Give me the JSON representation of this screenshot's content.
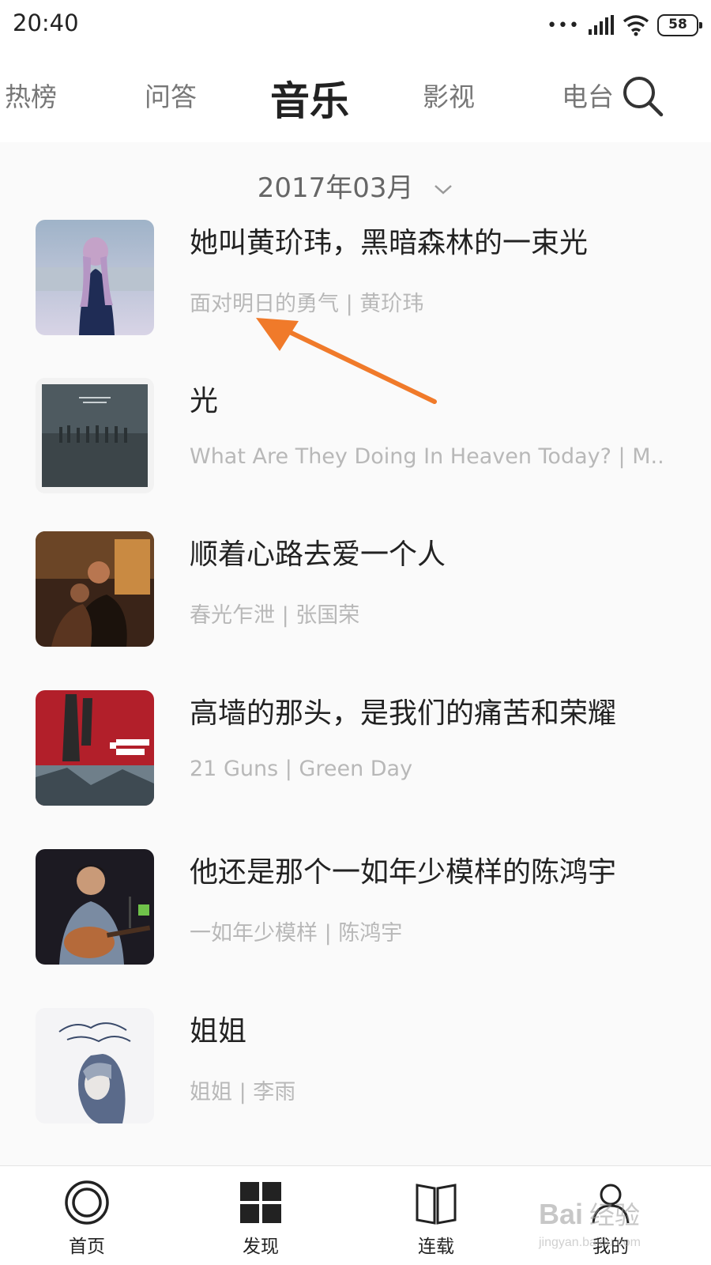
{
  "status_bar": {
    "time": "20:40",
    "signal_dots": "•••",
    "battery": "58",
    "icons": [
      "signal-icon",
      "wifi-icon",
      "battery-icon"
    ]
  },
  "top_nav": {
    "tabs": [
      {
        "label": "热榜",
        "active": false
      },
      {
        "label": "问答",
        "active": false
      },
      {
        "label": "音乐",
        "active": true
      },
      {
        "label": "影视",
        "active": false
      },
      {
        "label": "电台",
        "active": false
      }
    ],
    "search_icon": "search-icon"
  },
  "month_selector": {
    "label": "2017年03月",
    "icon": "chevron-down-icon"
  },
  "items": [
    {
      "title": "她叫黄玠玮，黑暗森林的一束光",
      "subtitle": "面对明日的勇气 | 黄玠玮"
    },
    {
      "title": "光",
      "subtitle": "What Are They Doing In Heaven Today? | M..."
    },
    {
      "title": "顺着心路去爱一个人",
      "subtitle": "春光乍泄 | 张国荣"
    },
    {
      "title": "高墙的那头，是我们的痛苦和荣耀",
      "subtitle": "21 Guns | Green Day"
    },
    {
      "title": "他还是那个一如年少模样的陈鸿宇",
      "subtitle": "一如年少模样 | 陈鸿宇"
    },
    {
      "title": "姐姐",
      "subtitle": "姐姐 | 李雨"
    }
  ],
  "annotation": {
    "color": "#f07a2a"
  },
  "bottom_nav": {
    "items": [
      {
        "label": "首页",
        "icon": "home-circle-icon"
      },
      {
        "label": "发现",
        "icon": "grid-icon"
      },
      {
        "label": "连载",
        "icon": "book-icon"
      },
      {
        "label": "我的",
        "icon": "user-icon"
      }
    ]
  },
  "watermark": {
    "text": "Bai 经验",
    "subtext": "jingyan.baidu.com"
  }
}
